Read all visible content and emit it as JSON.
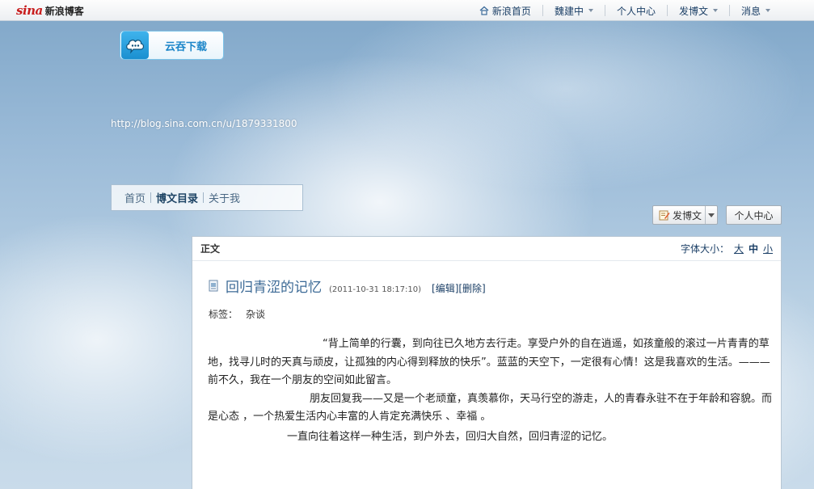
{
  "topbar": {
    "logo_mark": "sina",
    "logo_text": "新浪博客",
    "nav": [
      {
        "label": "新浪首页",
        "icon": "house-icon"
      },
      {
        "label": "魏建中",
        "dropdown": true
      },
      {
        "label": "个人中心"
      },
      {
        "label": "发博文",
        "dropdown": true
      },
      {
        "label": "消息",
        "dropdown": true
      }
    ]
  },
  "cloud_download": {
    "label": "云吞下载",
    "icon": "cloud-chat-icon"
  },
  "blog_url": "http://blog.sina.com.cn/u/1879331800",
  "blog_nav": [
    {
      "label": "首页",
      "active": false
    },
    {
      "label": "博文目录",
      "active": true
    },
    {
      "label": "关于我",
      "active": false
    }
  ],
  "actions": {
    "post_label": "发博文",
    "home_label": "个人中心"
  },
  "panel": {
    "title": "正文",
    "font_size_label": "字体大小：",
    "font_sizes": [
      "大",
      "中",
      "小"
    ],
    "current_font_size": "中"
  },
  "article": {
    "title": "回归青涩的记忆",
    "time": "(2011-10-31 18:17:10)",
    "edit_actions": "[编辑][删除]",
    "tag_label": "标签：",
    "tag": "杂谈",
    "paragraphs": [
      "“背上简单的行囊，到向往已久地方去行走。享受户外的自在逍遥，如孩童般的滚过一片青青的草地，找寻儿时的天真与顽皮，让孤独的内心得到释放的快乐”。蓝蓝的天空下，一定很有心情！这是我喜欢的生活。———前不久，我在一个朋友的空间如此留言。",
      "朋友回复我——又是一个老顽童，真羡慕你，天马行空的游走，人的青春永驻不在于年龄和容貌。而是心态 ，一个热爱生活内心丰富的人肯定充满快乐 、幸福 。",
      "一直向往着这样一种生活，到户外去，回归大自然，回归青涩的记忆。"
    ]
  },
  "colors": {
    "link": "#1b3f66",
    "title": "#3c6a96",
    "brand_red": "#c81d1d",
    "cloud_blue": "#1d86c9"
  }
}
